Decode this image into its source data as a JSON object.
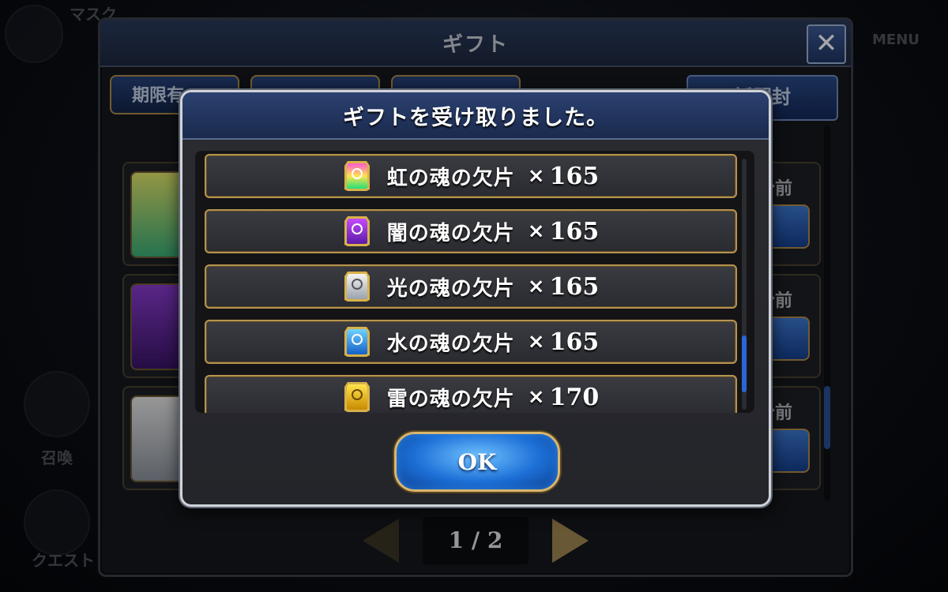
{
  "background": {
    "top_left_label": "マスク",
    "right_label": "MENU",
    "bottom_left_label": "クエスト",
    "summon_label": "召喚"
  },
  "gift_window": {
    "title": "ギフト",
    "close_label": "✕",
    "tab_expiring": "期限有",
    "open_all_label": "括開封",
    "row_time_label": "分前",
    "pager": "1 / 2"
  },
  "modal": {
    "title": "ギフトを受け取りました。",
    "items": [
      {
        "name": "虹の魂の欠片",
        "x": "×",
        "qty": "165",
        "color_top": "#ff5ad2",
        "color_bottom": "#22e07a"
      },
      {
        "name": "闇の魂の欠片",
        "x": "×",
        "qty": "165",
        "color_top": "#c54bff",
        "color_bottom": "#5b1aa8"
      },
      {
        "name": "光の魂の欠片",
        "x": "×",
        "qty": "165",
        "color_top": "#f4f4f4",
        "color_bottom": "#9aa2ad"
      },
      {
        "name": "水の魂の欠片",
        "x": "×",
        "qty": "165",
        "color_top": "#6fd2ff",
        "color_bottom": "#1460c8"
      },
      {
        "name": "雷の魂の欠片",
        "x": "×",
        "qty": "170",
        "color_top": "#ffe34d",
        "color_bottom": "#c98a00"
      }
    ],
    "ok_label": "OK"
  },
  "colors": {
    "accent_gold": "#b6934f",
    "header_blue": "#1a2a4e",
    "ok_blue": "#1c6fd6"
  }
}
